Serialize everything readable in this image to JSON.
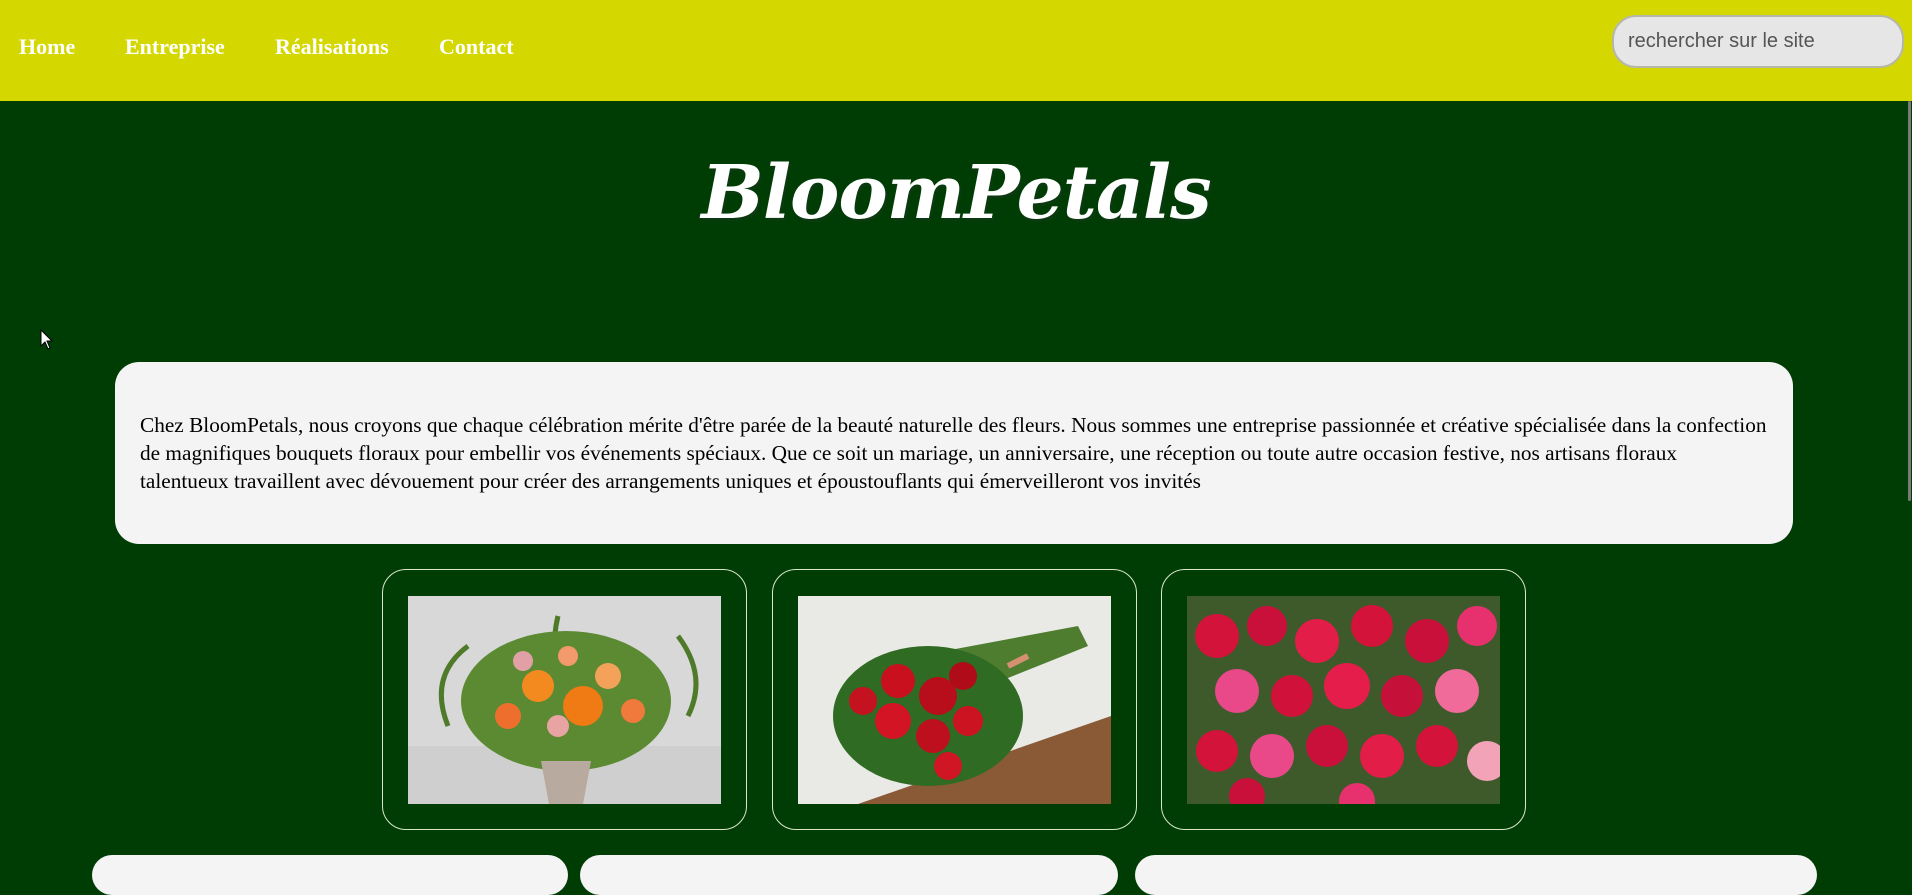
{
  "nav": {
    "items": [
      {
        "label": "Home"
      },
      {
        "label": "Entreprise"
      },
      {
        "label": "Réalisations"
      },
      {
        "label": "Contact"
      }
    ]
  },
  "search": {
    "placeholder": "rechercher sur le site",
    "value": ""
  },
  "brand": {
    "name": "BloomPetals"
  },
  "intro": {
    "text": "Chez BloomPetals, nous croyons que chaque célébration mérite d'être parée de la beauté naturelle des fleurs. Nous sommes une entreprise passionnée et créative spécialisée dans la confection de magnifiques bouquets floraux pour embellir vos événements spéciaux. Que ce soit un mariage, un anniversaire, une réception ou toute autre occasion festive, nos artisans floraux talentueux travaillent avec dévouement pour créer des arrangements uniques et époustouflants qui émerveilleront vos invités"
  },
  "gallery": {
    "photos": [
      {
        "icon": "orange-bouquet-photo"
      },
      {
        "icon": "red-roses-photo"
      },
      {
        "icon": "pink-red-bouquet-photo"
      }
    ]
  },
  "colors": {
    "header_bg": "#d4d700",
    "page_bg": "#003d05",
    "panel_bg": "#f4f4f4",
    "nav_text": "#ffffff"
  }
}
